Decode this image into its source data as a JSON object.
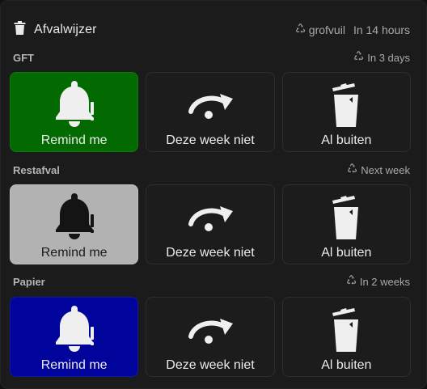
{
  "header": {
    "title": "Afvalwijzer",
    "next_type": "grofvuil",
    "next_when": "In 14 hours"
  },
  "sections": [
    {
      "name": "GFT",
      "when": "In 3 days",
      "buttons": {
        "remind": "Remind me",
        "skip": "Deze week niet",
        "out": "Al buiten"
      },
      "remind_color": "#026a00"
    },
    {
      "name": "Restafval",
      "when": "Next week",
      "buttons": {
        "remind": "Remind me",
        "skip": "Deze week niet",
        "out": "Al buiten"
      },
      "remind_color": "#b2b2b2"
    },
    {
      "name": "Papier",
      "when": "In 2 weeks",
      "buttons": {
        "remind": "Remind me",
        "skip": "Deze week niet",
        "out": "Al buiten"
      },
      "remind_color": "#01049b"
    }
  ],
  "icons": {
    "header": "trash-can-icon",
    "recycle": "recycle-icon",
    "remind": "bell-alert-icon",
    "skip": "redo-arrow-icon",
    "out": "trash-can-open-icon"
  }
}
